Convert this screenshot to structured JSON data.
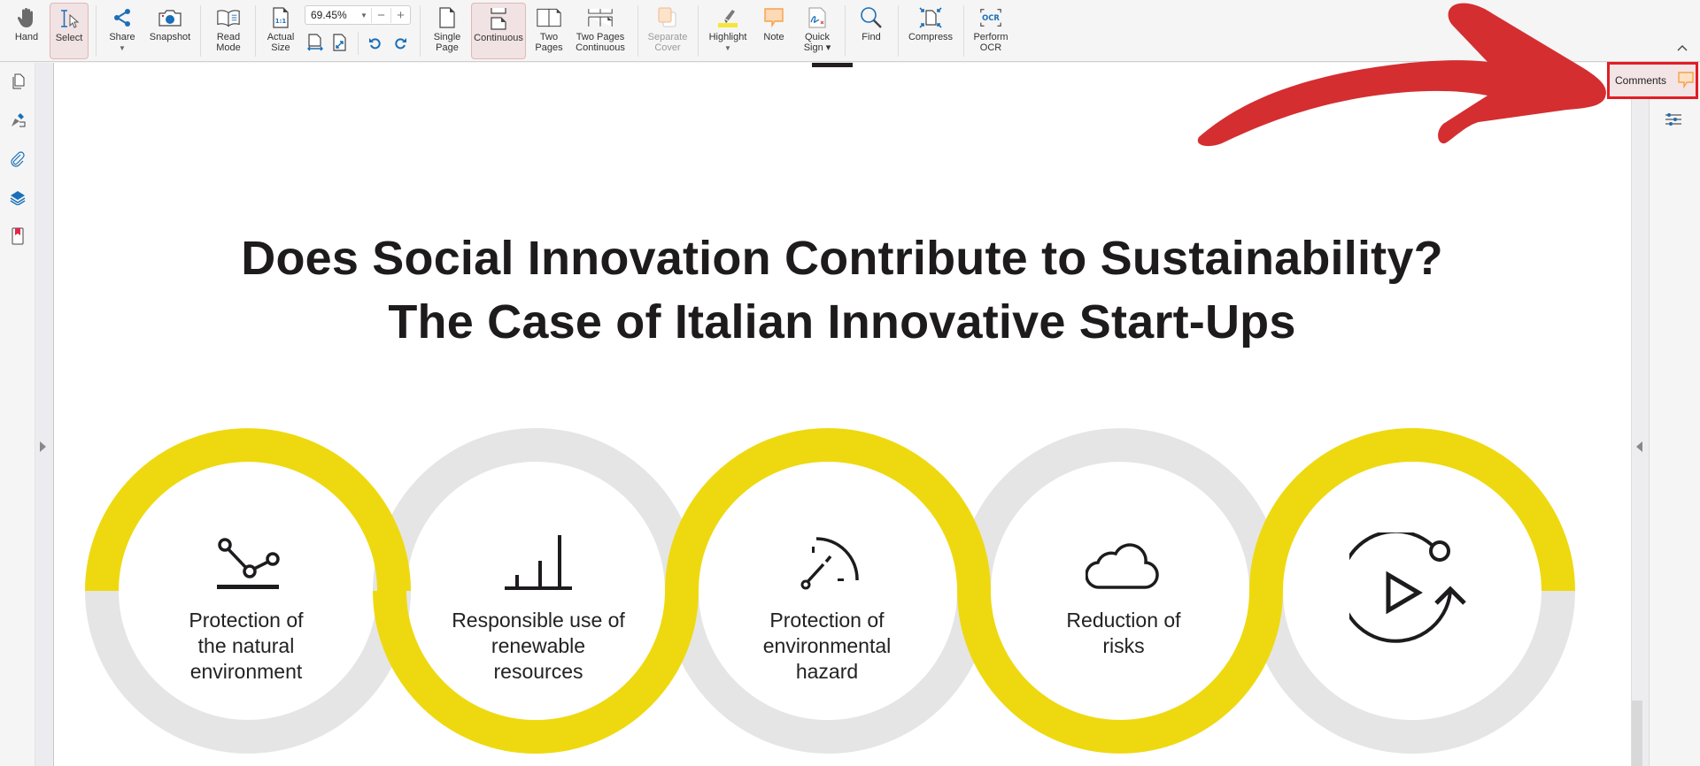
{
  "toolbar": {
    "hand": "Hand",
    "select": "Select",
    "share": "Share",
    "snapshot": "Snapshot",
    "read_mode": "Read\nMode",
    "actual_size": "Actual\nSize",
    "zoom_value": "69.45%",
    "zoom_minus": "−",
    "zoom_plus": "+",
    "single_page": "Single\nPage",
    "continuous": "Continuous",
    "two_pages": "Two\nPages",
    "two_pages_continuous": "Two Pages\nContinuous",
    "separate_cover": "Separate\nCover",
    "highlight": "Highlight",
    "note": "Note",
    "quick_sign": "Quick\nSign ▾",
    "find": "Find",
    "compress": "Compress",
    "perform_ocr": "Perform\nOCR",
    "active_view": "Continuous",
    "active_tool": "Select"
  },
  "left_rail": {
    "icons": [
      "pages-icon",
      "sign-pen-icon",
      "attachment-icon",
      "layers-icon",
      "bookmark-icon"
    ]
  },
  "right_rail": {
    "comments_label": "Comments",
    "properties_icon": "sliders-icon",
    "collapse_icon": "chevron-up-icon"
  },
  "document": {
    "title_line1": "Does Social Innovation Contribute to Sustainability?",
    "title_line2": "The Case of Italian Innovative Start-Ups",
    "circles": [
      {
        "label": "Protection of\nthe natural\nenvironment",
        "icon": "network-graph-icon",
        "ring": "yellow-top"
      },
      {
        "label": "Responsible use of\nrenewable\nresources",
        "icon": "bar-chart-icon",
        "ring": "yellow-bottom"
      },
      {
        "label": "Protection of\nenvironmental\nhazard",
        "icon": "gauge-icon",
        "ring": "yellow-top"
      },
      {
        "label": "Reduction of\nrisks",
        "icon": "cloud-icon",
        "ring": "yellow-bottom"
      },
      {
        "label": "",
        "icon": "play-cycle-icon",
        "ring": "yellow-top"
      }
    ]
  },
  "annotation": {
    "arrow_color": "#d42e31",
    "highlight_box_color": "#e21d25"
  },
  "colors": {
    "ring_yellow": "#eed910",
    "ring_gray": "#e5e5e5",
    "accent_blue": "#1a6fb8",
    "note_orange": "#f7a24a"
  }
}
